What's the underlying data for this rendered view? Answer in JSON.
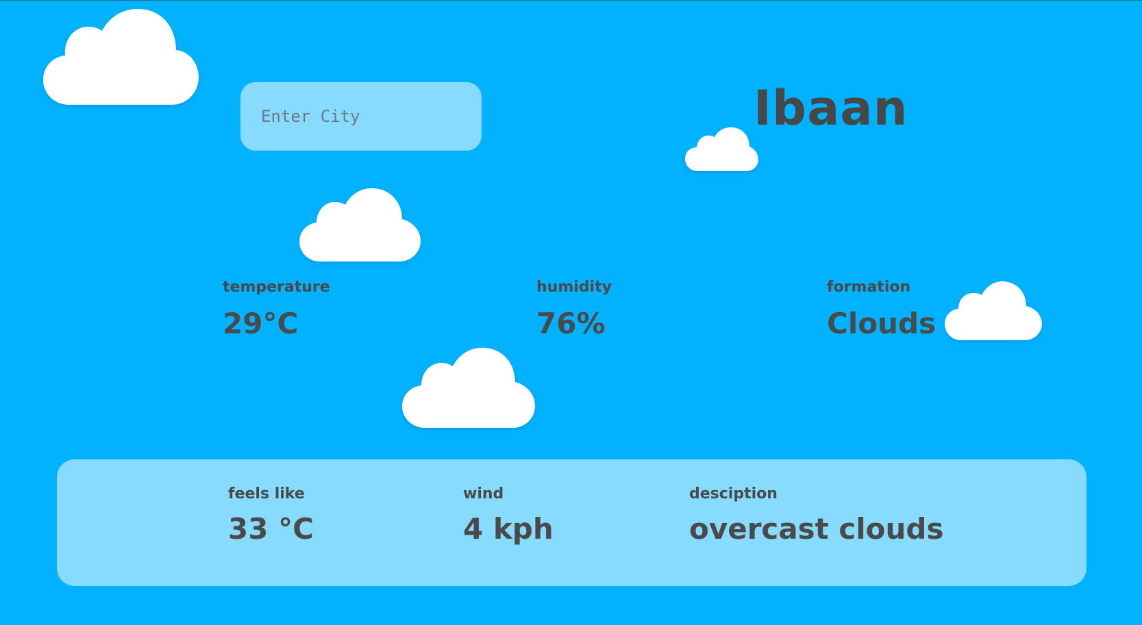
{
  "search": {
    "placeholder": "Enter City",
    "value": ""
  },
  "city": "Ibaan",
  "stats": {
    "temperature": {
      "label": "temperature",
      "value": "29°C"
    },
    "humidity": {
      "label": "humidity",
      "value": "76%"
    },
    "formation": {
      "label": "formation",
      "value": "Clouds"
    }
  },
  "details": {
    "feels_like": {
      "label": "feels like",
      "value": "33 °C"
    },
    "wind": {
      "label": "wind",
      "value": "4 kph"
    },
    "description": {
      "label": "desciption",
      "value": "overcast clouds"
    }
  },
  "colors": {
    "background": "#00b2ff",
    "panel": "#87dbff",
    "text": "#4a4a4a",
    "cloud": "#ffffff"
  }
}
